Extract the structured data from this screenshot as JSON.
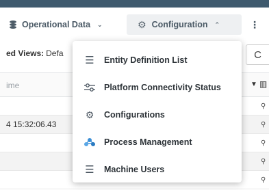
{
  "nav": {
    "operational_label": "Operational Data",
    "operational_chevron": "⌄",
    "configuration_label": "Configuration",
    "configuration_chevron": "⌃",
    "more_glyph": "⋮"
  },
  "saved_views": {
    "label": "ed Views:",
    "value": "Defa"
  },
  "table": {
    "header_label": "ime",
    "rows": [
      {
        "value": ""
      },
      {
        "value": "4 15:32:06.43"
      },
      {
        "value": ""
      },
      {
        "value": ""
      }
    ]
  },
  "menu": {
    "items": [
      {
        "label": "Entity Definition List",
        "icon": "hamburger-icon"
      },
      {
        "label": "Platform Connectivity Status",
        "icon": "sliders-icon"
      },
      {
        "label": "Configurations",
        "icon": "gear-icon"
      },
      {
        "label": "Process Management",
        "icon": "process-nodes-icon"
      },
      {
        "label": "Machine Users",
        "icon": "hamburger-icon"
      }
    ]
  },
  "colors": {
    "topbar": "#3f5a6e",
    "process_icon": "#3b8fd6"
  }
}
